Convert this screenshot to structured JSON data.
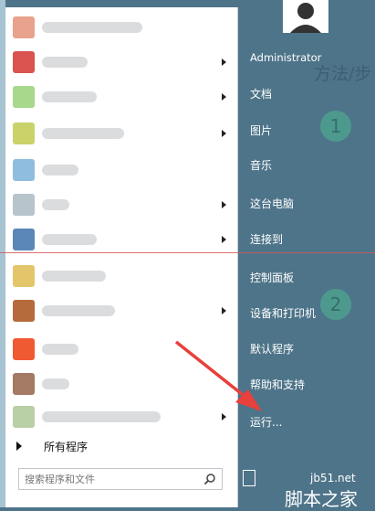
{
  "start_menu": {
    "all_programs": "所有程序",
    "search": {
      "placeholder": "搜索程序和文件"
    },
    "right_items": {
      "user": "Administrator",
      "documents": "文档",
      "pictures": "图片",
      "music": "音乐",
      "this_pc": "这台电脑",
      "connect_to": "连接到",
      "control_panel": "控制面板",
      "devices_printers": "设备和打印机",
      "default_programs": "默认程序",
      "help_support": "帮助和支持",
      "run": "运行..."
    }
  },
  "overlay": {
    "method_text": "方法/步",
    "step1": "1",
    "step2": "2",
    "watermark_site": "jb51.net",
    "watermark_name": "脚本之家"
  },
  "colors": {
    "menu_background": "#4e7489",
    "annotation_red": "#e8403c",
    "step_circle": "#4fa090"
  },
  "icons": {
    "search": "search-icon",
    "user": "user-avatar-icon",
    "arrow": "red-arrow"
  }
}
